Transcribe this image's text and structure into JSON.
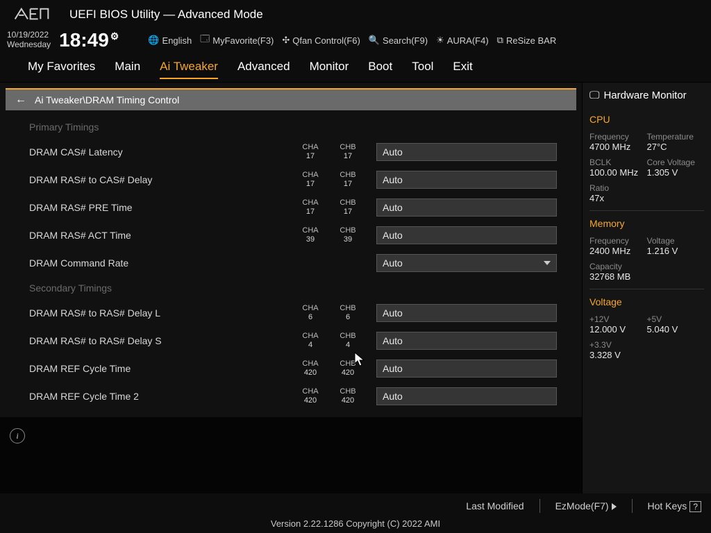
{
  "title": "UEFI BIOS Utility — Advanced Mode",
  "date": "10/19/2022",
  "day": "Wednesday",
  "time": "18:49",
  "toolbar": {
    "language": "English",
    "myfav": "MyFavorite(F3)",
    "qfan": "Qfan Control(F6)",
    "search": "Search(F9)",
    "aura": "AURA(F4)",
    "resize": "ReSize BAR"
  },
  "tabs": [
    "My Favorites",
    "Main",
    "Ai Tweaker",
    "Advanced",
    "Monitor",
    "Boot",
    "Tool",
    "Exit"
  ],
  "active_tab": 2,
  "breadcrumb": "Ai Tweaker\\DRAM Timing Control",
  "sections": {
    "primary": "Primary Timings",
    "secondary": "Secondary Timings"
  },
  "rows": [
    {
      "label": "DRAM CAS# Latency",
      "cha": "17",
      "chb": "17",
      "val": "Auto",
      "dd": false
    },
    {
      "label": "DRAM RAS# to CAS# Delay",
      "cha": "17",
      "chb": "17",
      "val": "Auto",
      "dd": false
    },
    {
      "label": "DRAM RAS# PRE Time",
      "cha": "17",
      "chb": "17",
      "val": "Auto",
      "dd": false
    },
    {
      "label": "DRAM RAS# ACT Time",
      "cha": "39",
      "chb": "39",
      "val": "Auto",
      "dd": false
    },
    {
      "label": "DRAM Command Rate",
      "cha": "",
      "chb": "",
      "val": "Auto",
      "dd": true
    },
    {
      "label": "DRAM RAS# to RAS# Delay L",
      "cha": "6",
      "chb": "6",
      "val": "Auto",
      "dd": false
    },
    {
      "label": "DRAM RAS# to RAS# Delay S",
      "cha": "4",
      "chb": "4",
      "val": "Auto",
      "dd": false
    },
    {
      "label": "DRAM REF Cycle Time",
      "cha": "420",
      "chb": "420",
      "val": "Auto",
      "dd": false
    },
    {
      "label": "DRAM REF Cycle Time 2",
      "cha": "420",
      "chb": "420",
      "val": "Auto",
      "dd": false
    }
  ],
  "ch_header": {
    "a": "CHA",
    "b": "CHB"
  },
  "hw": {
    "title": "Hardware Monitor",
    "cpu": "CPU",
    "cpu_items": [
      {
        "lbl": "Frequency",
        "val": "4700 MHz"
      },
      {
        "lbl": "Temperature",
        "val": "27°C"
      },
      {
        "lbl": "BCLK",
        "val": "100.00 MHz"
      },
      {
        "lbl": "Core Voltage",
        "val": "1.305 V"
      },
      {
        "lbl": "Ratio",
        "val": "47x"
      },
      {
        "lbl": "",
        "val": ""
      }
    ],
    "mem": "Memory",
    "mem_items": [
      {
        "lbl": "Frequency",
        "val": "2400 MHz"
      },
      {
        "lbl": "Voltage",
        "val": "1.216 V"
      },
      {
        "lbl": "Capacity",
        "val": "32768 MB"
      },
      {
        "lbl": "",
        "val": ""
      }
    ],
    "volt": "Voltage",
    "volt_items": [
      {
        "lbl": "+12V",
        "val": "12.000 V"
      },
      {
        "lbl": "+5V",
        "val": "5.040 V"
      },
      {
        "lbl": "+3.3V",
        "val": "3.328 V"
      },
      {
        "lbl": "",
        "val": ""
      }
    ]
  },
  "footer": {
    "last": "Last Modified",
    "ez": "EzMode(F7)",
    "hot": "Hot Keys",
    "copyright": "Version 2.22.1286 Copyright (C) 2022 AMI"
  }
}
